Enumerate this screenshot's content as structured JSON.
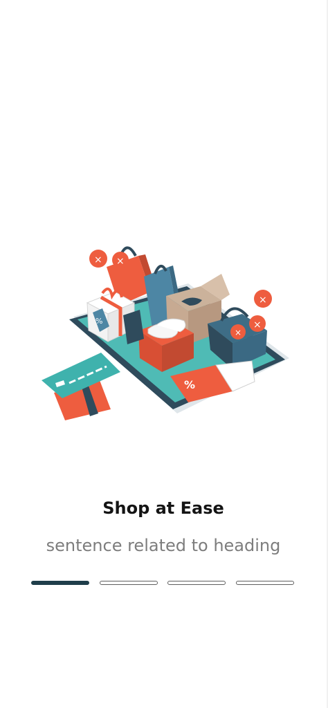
{
  "onboarding": {
    "heading": "Shop at Ease",
    "subtitle": "sentence related to heading",
    "illustration": {
      "name": "online-shopping-illustration",
      "icons": [
        "shopping-bag-icon",
        "gift-box-icon",
        "discount-tag-icon",
        "shopping-basket-icon",
        "credit-card-icon",
        "phone-icon",
        "sneakers-icon",
        "gamepad-icon"
      ]
    },
    "pager": {
      "total": 4,
      "active_index": 0
    }
  },
  "colors": {
    "heading": "#141414",
    "subtitle": "#7d7d7d",
    "pager_active": "#1f3e4a",
    "pager_inactive_border": "#5e5e5e",
    "teal": "#3fb2ad",
    "coral": "#ee5d3f",
    "navy": "#2f4b5c"
  }
}
